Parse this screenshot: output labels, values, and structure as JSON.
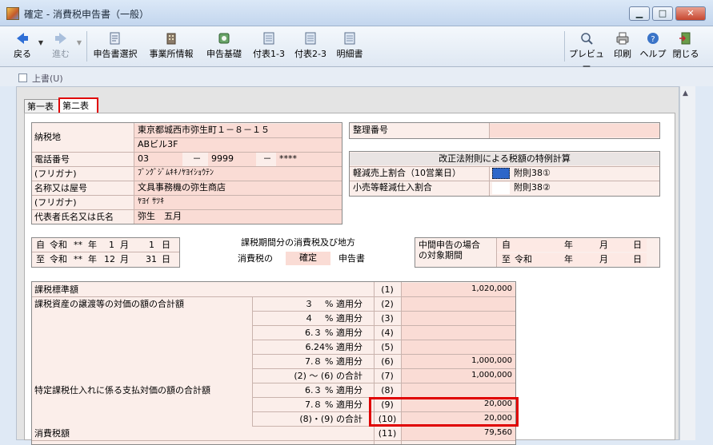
{
  "window": {
    "title": "確定 - 消費税申告書（一般）",
    "min": "▁",
    "max": "□",
    "close": "✕"
  },
  "toolbar": {
    "back": "戻る",
    "forward": "進む",
    "select": "申告書選択",
    "office": "事業所情報",
    "basis": "申告基礎",
    "t13": "付表1-3",
    "t23": "付表2-3",
    "detail": "明細書",
    "preview": "プレビュー",
    "print": "印刷",
    "help": "ヘルプ",
    "close": "閉じる"
  },
  "option": {
    "overwrite": "上書(U)"
  },
  "tabs": [
    "第一表",
    "第二表"
  ],
  "taxpayer": {
    "address_label": "納税地",
    "address1": "東京都城西市弥生町１－８－１５",
    "address2": "ABビル3F",
    "phone_label": "電話番号",
    "phone1": "03",
    "phone2": "9999",
    "phone3": "****",
    "dash": "－",
    "kana_label": "(フリガナ)",
    "kana": "ﾌﾞﾝｸﾞｼﾞﾑｷｷﾉﾔﾖｲｼｮｳﾃﾝ",
    "name_label": "名称又は屋号",
    "name": "文具事務機の弥生商店",
    "kana2_label": "(フリガナ)",
    "kana2": "ﾔﾖｲ ｻﾂｷ",
    "rep_label": "代表者氏名又は氏名",
    "rep": "弥生　五月"
  },
  "ref": {
    "label": "整理番号",
    "value": ""
  },
  "special": {
    "title": "改正法附則による税額の特例計算",
    "row1_label": "軽減売上割合（10営業日）",
    "row1_value": "附則38①",
    "row2_label": "小売等軽減仕入割合",
    "row2_value": "附則38②"
  },
  "period": {
    "from": "自",
    "to": "至",
    "era": "令和",
    "stars": "**",
    "nen": "年",
    "tsuki": "月",
    "hi": "日",
    "from_m": "1",
    "from_d": "1",
    "to_m": "12",
    "to_d": "31"
  },
  "center": {
    "line1": "課税期間分の消費税及び地方",
    "line2a": "消費税の",
    "status": "確定",
    "line2b": "申告書"
  },
  "interim": {
    "label1": "中間申告の場合",
    "label2": "の対象期間",
    "from": "自",
    "to": "至",
    "era": "令和",
    "nen": "年",
    "tsuki": "月",
    "hi": "日"
  },
  "rows": [
    {
      "label": "課税標準額",
      "sub": "",
      "no": "(1)",
      "value": "1,020,000"
    },
    {
      "label": "課税資産の譲渡等の対価の額の合計額",
      "sub": "３　 %  適用分",
      "no": "(2)",
      "value": ""
    },
    {
      "label": "",
      "sub": "４　 %  適用分",
      "no": "(3)",
      "value": ""
    },
    {
      "label": "",
      "sub": "6.３ %  適用分",
      "no": "(4)",
      "value": ""
    },
    {
      "label": "",
      "sub": "6.24%  適用分",
      "no": "(5)",
      "value": ""
    },
    {
      "label": "",
      "sub": "7.８ %  適用分",
      "no": "(6)",
      "value": "1,000,000"
    },
    {
      "label": "",
      "sub": "(2) ～ (6)  の合計",
      "no": "(7)",
      "value": "1,000,000"
    },
    {
      "label": "特定課税仕入れに係る支払対価の額の合計額",
      "sub": "6.３ %  適用分",
      "no": "(8)",
      "value": ""
    },
    {
      "label": "",
      "sub": "7.８ %  適用分",
      "no": "(9)",
      "value": "20,000"
    },
    {
      "label": "",
      "sub": "(8)・(9)  の合計",
      "no": "(10)",
      "value": "20,000"
    },
    {
      "label": "消費税額",
      "sub": "",
      "no": "(11)",
      "value": "79,560"
    }
  ],
  "colors": {
    "accent_red": "#e00000",
    "cell_pink": "#fadcd5"
  }
}
